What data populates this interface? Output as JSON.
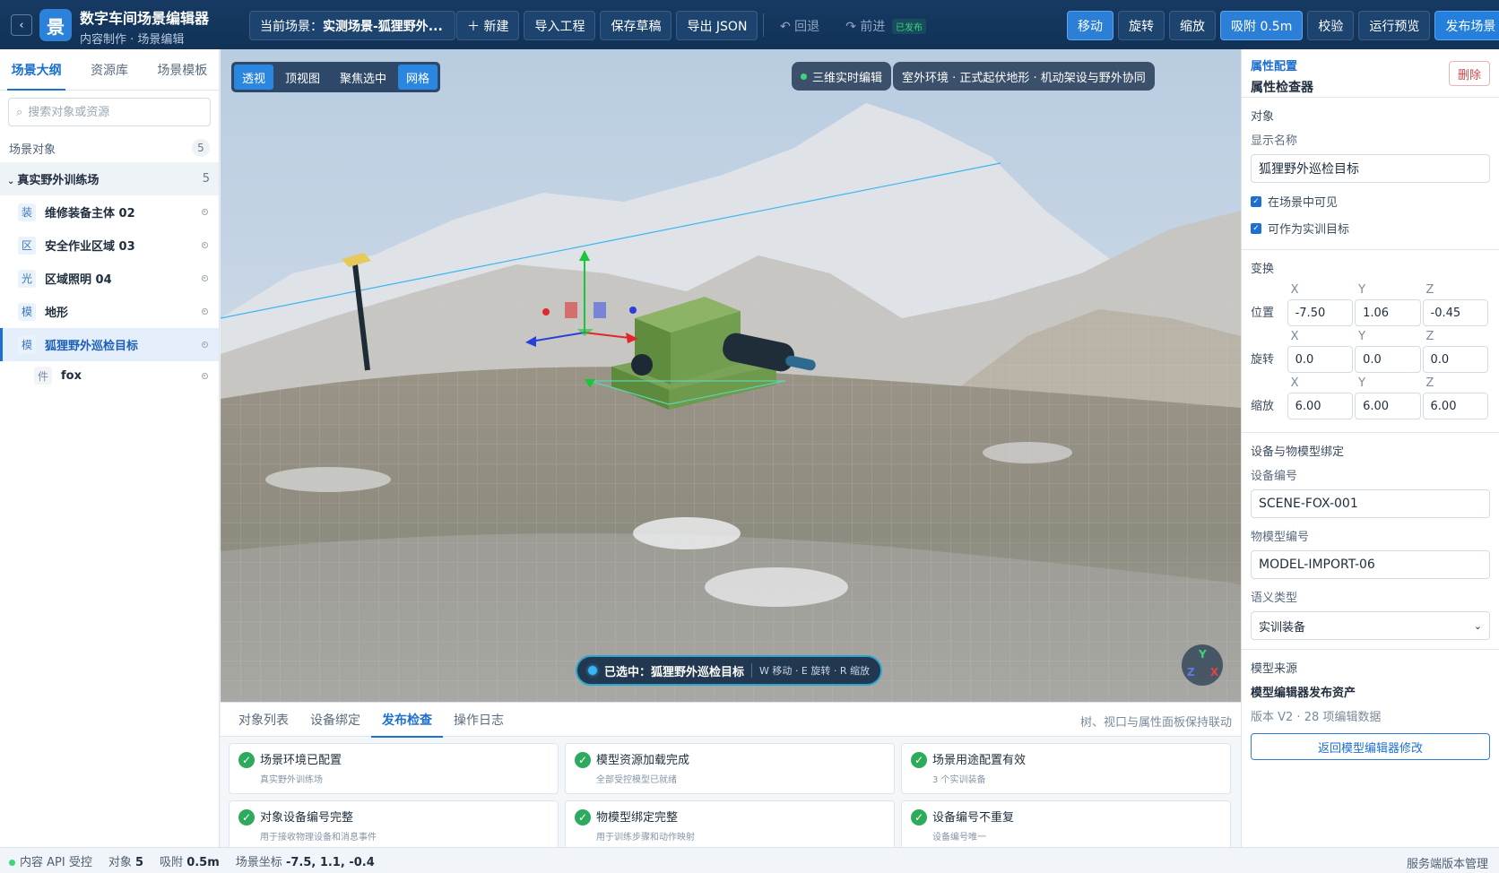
{
  "header": {
    "back": "‹",
    "logo": "景",
    "title": "数字车间场景编辑器",
    "subtitle": "内容制作 · 场景编辑",
    "scene_prefix": "当前场景：",
    "scene_name": "实测场景-狐狸野外...",
    "new_btn": "＋ 新建",
    "import_btn": "导入工程",
    "save_btn": "保存草稿",
    "export_btn": "导出 JSON",
    "undo_btn": "↶ 回退",
    "redo_btn": "↷ 前进",
    "published_badge": "已发布",
    "move_btn": "移动",
    "rotate_btn": "旋转",
    "scale_btn": "缩放",
    "snap_btn": "吸附 0.5m",
    "verify_btn": "校验",
    "preview_btn": "运行预览",
    "publish_btn": "发布场景"
  },
  "left": {
    "tabs": [
      "场景大纲",
      "资源库",
      "场景模板"
    ],
    "search_placeholder": "搜索对象或资源",
    "section_title": "场景对象",
    "section_count": "5",
    "group_name": "真实野外训练场",
    "group_count": "5",
    "items": [
      {
        "icon": "装",
        "label": "维修装备主体 02"
      },
      {
        "icon": "区",
        "label": "安全作业区域 03"
      },
      {
        "icon": "光",
        "label": "区域照明 04"
      },
      {
        "icon": "模",
        "label": "地形"
      },
      {
        "icon": "模",
        "label": "狐狸野外巡检目标"
      }
    ],
    "child": {
      "icon": "件",
      "label": "fox"
    }
  },
  "viewport": {
    "view_buttons": [
      "透视",
      "顶视图",
      "聚焦选中",
      "网格"
    ],
    "live_label": "三维实时编辑",
    "env_label": "室外环境 · 正式起伏地形 · 机动架设与野外协同",
    "selected_label": "已选中：狐狸野外巡检目标",
    "shortcut_hint": "W 移动 · E 旋转 · R 缩放",
    "gizmo": {
      "y": "Y",
      "z": "Z",
      "x": "X"
    }
  },
  "bottom": {
    "tabs": [
      "对象列表",
      "设备绑定",
      "发布检查",
      "操作日志"
    ],
    "note": "树、视口与属性面板保持联动",
    "checks": [
      {
        "title": "场景环境已配置",
        "desc": "真实野外训练场"
      },
      {
        "title": "模型资源加载完成",
        "desc": "全部受控模型已就绪"
      },
      {
        "title": "场景用途配置有效",
        "desc": "3 个实训装备"
      },
      {
        "title": "对象设备编号完整",
        "desc": "用于接收物理设备和消息事件"
      },
      {
        "title": "物模型绑定完整",
        "desc": "用于训练步骤和动作映射"
      },
      {
        "title": "设备编号不重复",
        "desc": "设备编号唯一"
      }
    ],
    "check_icon": "✓"
  },
  "inspector": {
    "kicker": "属性配置",
    "title": "属性检查器",
    "delete_btn": "删除",
    "object_section": "对象",
    "display_name_label": "显示名称",
    "display_name": "狐狸野外巡检目标",
    "visible_label": "在场景中可见",
    "target_label": "可作为实训目标",
    "transform_section": "变换",
    "axes": [
      "X",
      "Y",
      "Z"
    ],
    "position_label": "位置",
    "position": [
      "-7.50",
      "1.06",
      "-0.45"
    ],
    "rotation_label": "旋转",
    "rotation": [
      "0.0",
      "0.0",
      "0.0"
    ],
    "scale_label": "缩放",
    "scale": [
      "6.00",
      "6.00",
      "6.00"
    ],
    "binding_section": "设备与物模型绑定",
    "device_id_label": "设备编号",
    "device_id": "SCENE-FOX-001",
    "model_id_label": "物模型编号",
    "model_id": "MODEL-IMPORT-06",
    "semantic_label": "语义类型",
    "semantic_value": "实训装备",
    "source_section": "模型来源",
    "source_title": "模型编辑器发布资产",
    "source_version": "版本 V2 · 28 项编辑数据",
    "return_btn": "返回模型编辑器修改"
  },
  "status": {
    "api": "内容 API 受控",
    "objects_label": "对象",
    "objects_value": "5",
    "snap_label": "吸附",
    "snap_value": "0.5m",
    "coord_label": "场景坐标",
    "coord_value": "-7.5, 1.1, -0.4",
    "right_link": "服务端版本管理"
  },
  "colors": {
    "header_bg": "#163a63",
    "accent": "#1d6fd1",
    "success": "#2eaa5c",
    "danger": "#d44848",
    "model_green": "#6e9a4c"
  }
}
